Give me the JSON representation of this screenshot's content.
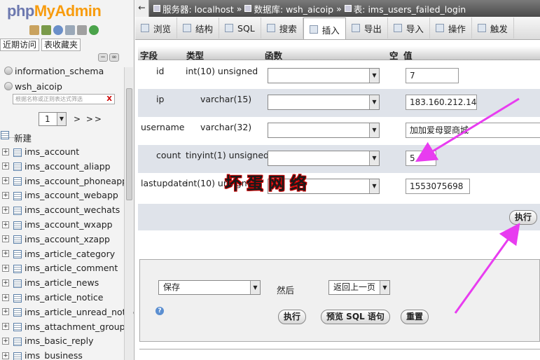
{
  "nav": {
    "logo_php": "php",
    "logo_myadmin": "MyAdmin",
    "recent_tab": "近期访问",
    "favorites_tab": "表收藏夹",
    "collapse": "−",
    "link": "∞",
    "databases": [
      "information_schema",
      "wsh_aicoip"
    ],
    "filter_placeholder": "根据名称或正则表达式筛选",
    "filter_clear": "X",
    "page_value": "1",
    "pager_next": "> >>",
    "new_label": "新建",
    "tables": [
      "ims_account",
      "ims_account_aliapp",
      "ims_account_phoneapp",
      "ims_account_webapp",
      "ims_account_wechats",
      "ims_account_wxapp",
      "ims_account_xzapp",
      "ims_article_category",
      "ims_article_comment",
      "ims_article_news",
      "ims_article_notice",
      "ims_article_unread_notice",
      "ims_attachment_group",
      "ims_basic_reply",
      "ims_business"
    ]
  },
  "breadcrumb": {
    "back": "←",
    "server": "服务器: localhost",
    "database": "数据库: wsh_aicoip",
    "table": "表: ims_users_failed_login",
    "sep": "»"
  },
  "tabs": [
    "浏览",
    "结构",
    "SQL",
    "搜索",
    "插入",
    "导出",
    "导入",
    "操作",
    "触发"
  ],
  "active_tab": "插入",
  "grid": {
    "headers": {
      "field": "字段",
      "type": "类型",
      "function": "函数",
      "null": "空",
      "value": "值"
    },
    "rows": [
      {
        "field": "id",
        "type": "int(10) unsigned",
        "value": "7"
      },
      {
        "field": "ip",
        "type": "varchar(15)",
        "value": "183.160.212.14"
      },
      {
        "field": "username",
        "type": "varchar(32)",
        "value": "加加爱母婴商城"
      },
      {
        "field": "count",
        "type": "tinyint(1) unsigned",
        "value": "5"
      },
      {
        "field": "lastupdate",
        "type": "int(10) unsigned",
        "value": "1553075698"
      }
    ]
  },
  "execute_label": "执行",
  "bottom": {
    "action_select": "保存",
    "then_label": "然后",
    "then_select": "返回上一页",
    "help": "?",
    "execute": "执行",
    "preview_sql": "预览 SQL 语句",
    "reset": "重置"
  },
  "watermark": "坏蛋网络",
  "colors": {
    "arrow": "#e83cf0",
    "accent_row": "#dfe3ea",
    "logo_php": "#6c78af",
    "logo_myadmin": "#f89c0e"
  },
  "icons": [
    "home-icon",
    "logout-icon",
    "help-icon",
    "docs-icon",
    "settings-icon",
    "reload-icon"
  ]
}
